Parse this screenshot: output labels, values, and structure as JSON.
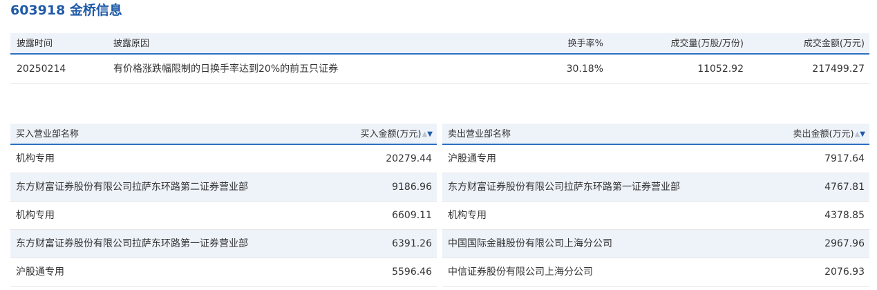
{
  "page_title": "603918 金桥信息",
  "summary": {
    "headers": {
      "date": "披露时间",
      "reason": "披露原因",
      "turnover": "换手率%",
      "volume": "成交量(万股/万份)",
      "amount": "成交金额(万元)"
    },
    "row": {
      "date": "20250214",
      "reason": "有价格涨跌幅限制的日换手率达到20%的前五只证券",
      "turnover": "30.18%",
      "volume": "11052.92",
      "amount": "217499.27"
    }
  },
  "buy": {
    "header_name": "买入营业部名称",
    "header_amount": "买入金额(万元)",
    "rows": [
      {
        "name": "机构专用",
        "amount": "20279.44"
      },
      {
        "name": "东方财富证券股份有限公司拉萨东环路第二证券营业部",
        "amount": "9186.96"
      },
      {
        "name": "机构专用",
        "amount": "6609.11"
      },
      {
        "name": "东方财富证券股份有限公司拉萨东环路第一证券营业部",
        "amount": "6391.26"
      },
      {
        "name": "沪股通专用",
        "amount": "5596.46"
      }
    ]
  },
  "sell": {
    "header_name": "卖出营业部名称",
    "header_amount": "卖出金额(万元)",
    "rows": [
      {
        "name": "沪股通专用",
        "amount": "7917.64"
      },
      {
        "name": "东方财富证券股份有限公司拉萨东环路第一证券营业部",
        "amount": "4767.81"
      },
      {
        "name": "机构专用",
        "amount": "4378.85"
      },
      {
        "name": "中国国际金融股份有限公司上海分公司",
        "amount": "2967.96"
      },
      {
        "name": "中信证券股份有限公司上海分公司",
        "amount": "2076.93"
      }
    ]
  },
  "sort_icons": {
    "up": "▲",
    "down": "▼"
  },
  "colors": {
    "accent": "#1f5aa8",
    "header_bg": "#eef3fa",
    "border_accent": "#2a6fc3"
  }
}
